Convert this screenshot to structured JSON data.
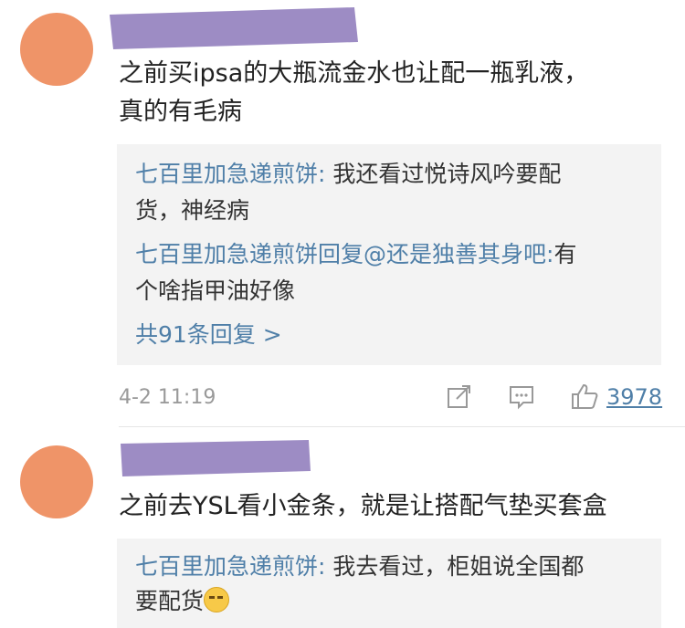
{
  "comments": [
    {
      "text_lines": [
        "之前买ipsa的大瓶流金水也让配一瓶乳液，",
        "真的有毛病"
      ],
      "replies": [
        {
          "user": "七百里加急递煎饼",
          "sep": ": ",
          "text_line1": "我还看过悦诗风吟要配",
          "text_line2": "货，神经病"
        },
        {
          "user": "七百里加急递煎饼",
          "sep": "回复@还是独善其身吧:",
          "text_line1": "有",
          "text_line2": "个啥指甲油好像"
        }
      ],
      "more_replies": "共91条回复 >",
      "timestamp": "4-2 11:19",
      "like_count": "3978"
    },
    {
      "text_lines": [
        "之前去YSL看小金条，就是让搭配气垫买套盒"
      ],
      "replies": [
        {
          "user": "七百里加急递煎饼",
          "sep": ": ",
          "text_line1": "我去看过，柜姐说全国都",
          "text_line2": "要配货"
        }
      ]
    }
  ],
  "colors": {
    "username": "#4f7fa8",
    "avatar": "#ef9468",
    "redaction": "#9d8cc4",
    "reply_bg": "#f3f3f3"
  },
  "icons": [
    "repost-icon",
    "comment-icon",
    "like-icon",
    "smirk-emoji-icon"
  ]
}
